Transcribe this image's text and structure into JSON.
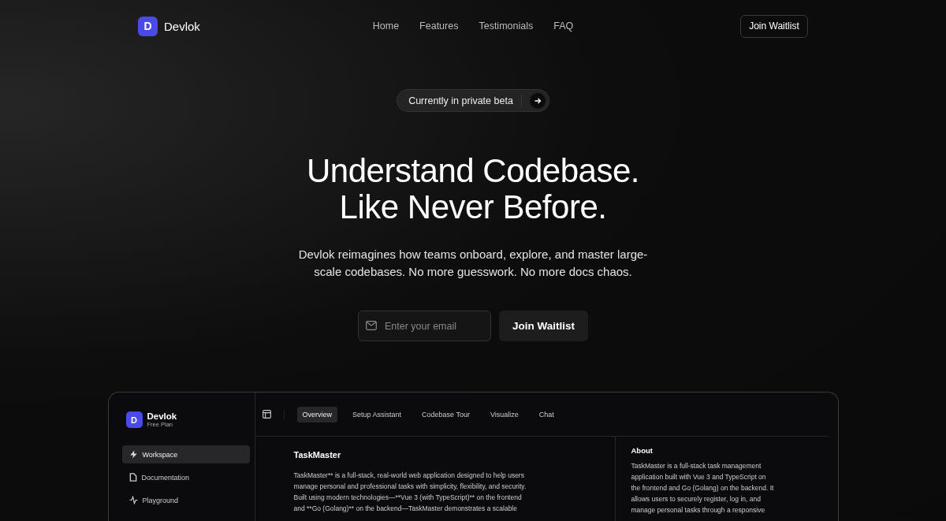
{
  "nav": {
    "logo_letter": "D",
    "brand": "Devlok",
    "links": [
      {
        "label": "Home"
      },
      {
        "label": "Features"
      },
      {
        "label": "Testimonials"
      },
      {
        "label": "FAQ"
      }
    ],
    "cta": "Join Waitlist"
  },
  "hero": {
    "badge": "Currently in private beta",
    "title_lines": [
      "Understand Codebase.",
      "Like Never Before."
    ],
    "subtitle": "Devlok reimagines how teams onboard, explore, and master large-scale codebases. No more guesswork. No more docs chaos.",
    "email_placeholder": "Enter your email",
    "submit": "Join Waitlist"
  },
  "preview": {
    "logo_letter": "D",
    "brand": "Devlok",
    "plan": "Free Plan",
    "sidebar": [
      {
        "label": "Workspace",
        "selected": true
      },
      {
        "label": "Documentation",
        "selected": false
      },
      {
        "label": "Playground",
        "selected": false
      }
    ],
    "tabs": [
      {
        "label": "Overview",
        "selected": true
      },
      {
        "label": "Setup Assistant",
        "selected": false
      },
      {
        "label": "Codebase Tour",
        "selected": false
      },
      {
        "label": "Visualize",
        "selected": false
      },
      {
        "label": "Chat",
        "selected": false
      }
    ],
    "project_title": "TaskMaster",
    "description_lines": [
      "TaskMaster** is a full-stack, real-world web application designed to help users",
      "manage personal and professional tasks with simplicity, flexibility, and security.",
      "Built using modern technologies—**Vue 3 (with TypeScript)** on the frontend",
      "and **Go (Golang)** on the backend—TaskMaster demonstrates a scalable"
    ],
    "about_title": "About",
    "about_lines": [
      "TaskMaster is a full-stack task management",
      "application built with Vue 3 and TypeScript on",
      "the frontend and Go (Golang) on the backend. It",
      "allows users to securely register, log in, and",
      "manage personal tasks through a responsive"
    ]
  }
}
